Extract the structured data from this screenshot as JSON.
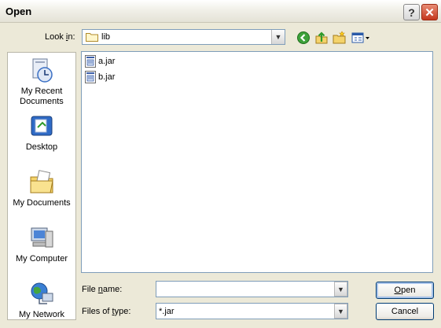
{
  "window": {
    "title": "Open",
    "help_icon": "question-mark-icon",
    "close_icon": "close-x-icon"
  },
  "lookin": {
    "label_pre": "Look ",
    "label_ul": "i",
    "label_post": "n:",
    "value": "lib"
  },
  "toolbar": {
    "icons": [
      "back-icon",
      "up-folder-icon",
      "new-folder-icon",
      "views-menu-icon"
    ]
  },
  "places": [
    {
      "label_line1": "My Recent",
      "label_line2": "Documents",
      "icon": "recent-documents-icon"
    },
    {
      "label_line1": "Desktop",
      "label_line2": "",
      "icon": "desktop-icon"
    },
    {
      "label_line1": "My Documents",
      "label_line2": "",
      "icon": "my-documents-icon"
    },
    {
      "label_line1": "My Computer",
      "label_line2": "",
      "icon": "my-computer-icon"
    },
    {
      "label_line1": "My Network",
      "label_line2": "",
      "icon": "my-network-icon"
    }
  ],
  "files": [
    {
      "name": "a.jar",
      "icon": "jar-file-icon"
    },
    {
      "name": "b.jar",
      "icon": "jar-file-icon"
    }
  ],
  "filename": {
    "label_pre": "File ",
    "label_ul": "n",
    "label_post": "ame:",
    "value": ""
  },
  "filetype": {
    "label_pre": "Files of ",
    "label_ul": "t",
    "label_post": "ype:",
    "value": "*.jar"
  },
  "buttons": {
    "open_ul": "O",
    "open_rest": "pen",
    "cancel": "Cancel"
  },
  "colors": {
    "dialog_bg": "#ece9d8",
    "field_border": "#7f9db9",
    "close_red": "#c4381d",
    "button_border": "#003c74"
  }
}
